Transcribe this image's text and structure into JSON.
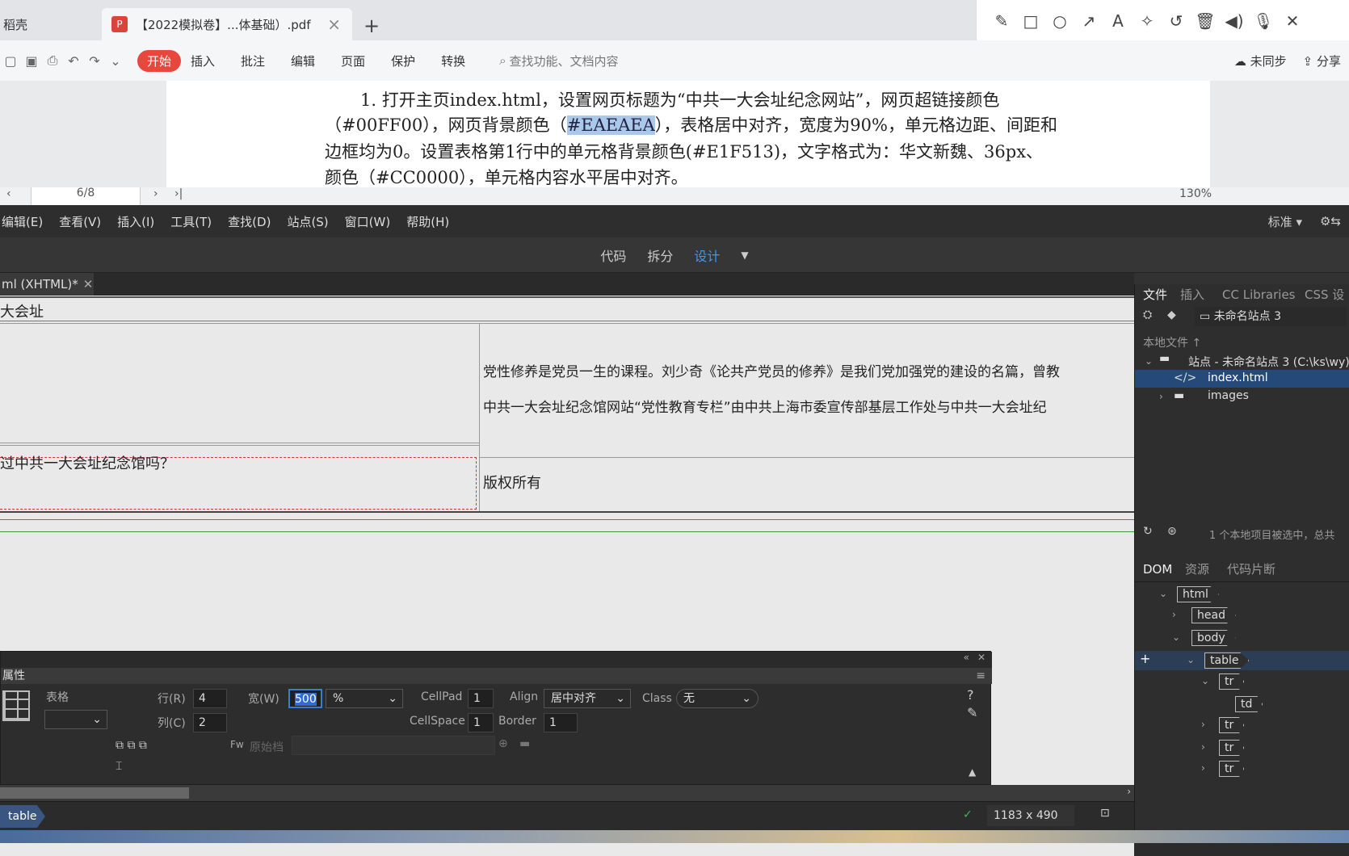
{
  "pdf": {
    "tabs": [
      {
        "label": "稻壳"
      },
      {
        "label": "【2022模拟卷】...体基础）.pdf"
      }
    ],
    "annot_icons": [
      "pencil-icon",
      "rectangle-icon",
      "circle-icon",
      "arrow-icon",
      "text-icon",
      "magic-wand-icon",
      "undo-icon",
      "trash-icon",
      "speaker-icon",
      "microphone-icon",
      "close-icon"
    ],
    "ribbon": {
      "menus": [
        "开始",
        "插入",
        "批注",
        "编辑",
        "页面",
        "保护",
        "转换"
      ],
      "search_placeholder": "查找功能、文档内容",
      "sync": "未同步",
      "share": "分享"
    },
    "page_lines": [
      "1. 打开主页index.html，设置网页标题为“中共一大会址纪念网站”，网页超链接颜色",
      "（#00FF00），网页背景颜色（",
      "#EAEAEA",
      "），表格居中对齐，宽度为90%，单元格边距、间距和",
      "边框均为0。设置表格第1行中的单元格背景颜色(#E1F513)，文字格式为：华文新魏、36px、",
      "颜色（#CC0000），单元格内容水平居中对齐。"
    ],
    "page_number": "6/8",
    "zoom": "130%"
  },
  "dw": {
    "menu": [
      "编辑(E)",
      "查看(V)",
      "插入(I)",
      "工具(T)",
      "查找(D)",
      "站点(S)",
      "窗口(W)",
      "帮助(H)"
    ],
    "workspace": "标准",
    "views": [
      "代码",
      "拆分",
      "设计"
    ],
    "doc_tab": "ml (XHTML)*",
    "canvas": {
      "title_cell": "大会址",
      "paragraph1": "党性修养是党员一生的课程。刘少奇《论共产党员的修养》是我们党加强党的建设的名篇，曾教",
      "paragraph2": "中共一大会址纪念馆网站“党性教育专栏”由中共上海市委宣传部基层工作处与中共一大会址纪",
      "question": "过中共一大会址纪念馆吗？",
      "copyright": "版权所有"
    },
    "props": {
      "title": "属性",
      "table_label": "表格",
      "rows_label": "行(R)",
      "rows": "4",
      "cols_label": "列(C)",
      "cols": "2",
      "width_label": "宽(W)",
      "width": "500",
      "width_unit": "%",
      "cellpad_label": "CellPad",
      "cellpad": "1",
      "cellspace_label": "CellSpace",
      "cellspace": "1",
      "align_label": "Align",
      "align": "居中对齐",
      "border_label": "Border",
      "border": "1",
      "class_label": "Class",
      "class": "无",
      "source_label": "原始档"
    },
    "status": {
      "tag": "table",
      "size": "1183 x 490"
    },
    "files": {
      "tabs": [
        "文件",
        "插入",
        "CC Libraries",
        "CSS 设"
      ],
      "site_select": "未命名站点 3",
      "local_label": "本地文件 ↑",
      "site_root": "站点 - 未命名站点 3 (C:\\ks\\wy)",
      "items": [
        "index.html",
        "images"
      ],
      "footer": "1 个本地项目被选中，总共"
    },
    "dom": {
      "tabs": [
        "DOM",
        "资源",
        "代码片断"
      ],
      "nodes": [
        "html",
        "head",
        "body",
        "table",
        "tr",
        "td",
        "tr",
        "tr",
        "tr"
      ]
    }
  }
}
